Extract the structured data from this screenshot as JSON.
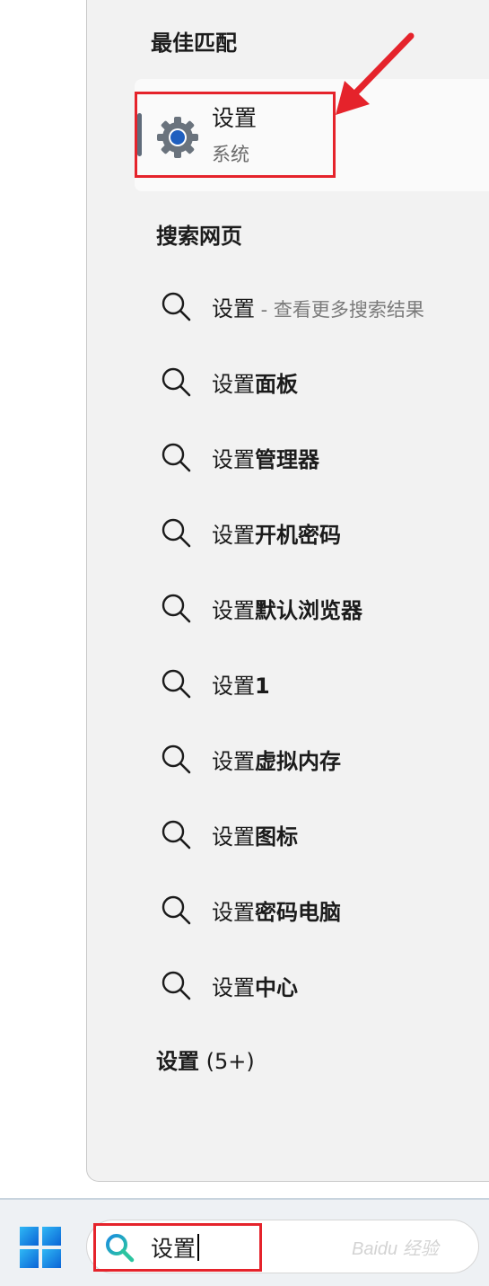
{
  "best_match": {
    "section_title": "最佳匹配",
    "app_name": "设置",
    "app_category": "系统"
  },
  "web_search": {
    "section_title": "搜索网页",
    "results": [
      {
        "prefix": "设置",
        "suffix": "",
        "hint": " - 查看更多搜索结果"
      },
      {
        "prefix": "设置",
        "suffix": "面板",
        "hint": ""
      },
      {
        "prefix": "设置",
        "suffix": "管理器",
        "hint": ""
      },
      {
        "prefix": "设置",
        "suffix": "开机密码",
        "hint": ""
      },
      {
        "prefix": "设置",
        "suffix": "默认浏览器",
        "hint": ""
      },
      {
        "prefix": "设置",
        "suffix": "1",
        "hint": ""
      },
      {
        "prefix": "设置",
        "suffix": "虚拟内存",
        "hint": ""
      },
      {
        "prefix": "设置",
        "suffix": "图标",
        "hint": ""
      },
      {
        "prefix": "设置",
        "suffix": "密码电脑",
        "hint": ""
      },
      {
        "prefix": "设置",
        "suffix": "中心",
        "hint": ""
      }
    ]
  },
  "settings_section": {
    "title": "设置",
    "count": " (5+)"
  },
  "taskbar": {
    "search_query": "设置",
    "watermark": "Baidu 经验"
  },
  "icons": {
    "settings": "gear-icon",
    "result": "search-icon",
    "start": "windows-logo-icon"
  },
  "colors": {
    "highlight": "#e5232b",
    "panel_bg": "#f2f2f2",
    "gear_center": "#1f5fbf"
  }
}
